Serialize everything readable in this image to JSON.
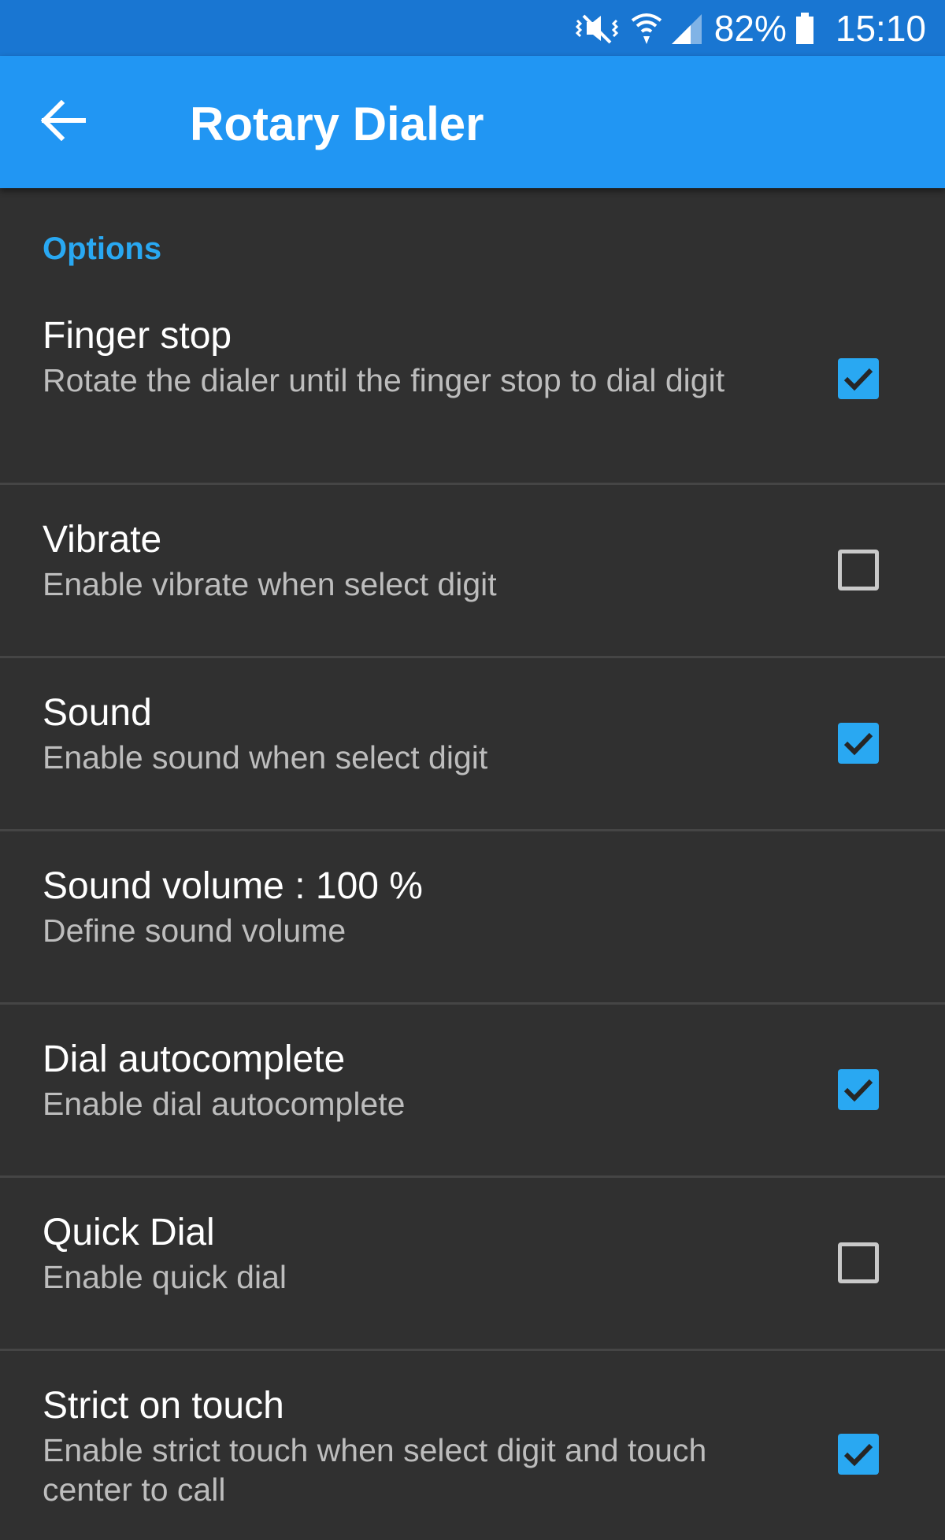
{
  "status_bar": {
    "icons": [
      "mute-vibrate-icon",
      "wifi-icon",
      "signal-icon",
      "battery-icon"
    ],
    "battery": "82%",
    "time": "15:10"
  },
  "app_bar": {
    "back_icon": "arrow-back-icon",
    "title": "Rotary Dialer"
  },
  "section": {
    "title": "Options"
  },
  "preferences": [
    {
      "title": "Finger stop",
      "summary": "Rotate the dialer until the finger stop to dial digit",
      "checked": true
    },
    {
      "title": "Vibrate",
      "summary": "Enable vibrate when select digit",
      "checked": false
    },
    {
      "title": "Sound",
      "summary": "Enable sound when select digit",
      "checked": true
    },
    {
      "title": "Sound volume : 100 %",
      "summary": "Define sound volume"
    },
    {
      "title": "Dial autocomplete",
      "summary": "Enable dial autocomplete",
      "checked": true
    },
    {
      "title": "Quick Dial",
      "summary": "Enable quick dial",
      "checked": false
    },
    {
      "title": "Strict on touch",
      "summary": "Enable strict touch when select digit and touch center to call",
      "checked": true
    }
  ],
  "colors": {
    "status_bar": "#1976d2",
    "app_bar": "#2196f3",
    "background": "#303030",
    "accent": "#29a8f2",
    "divider": "#454545"
  }
}
